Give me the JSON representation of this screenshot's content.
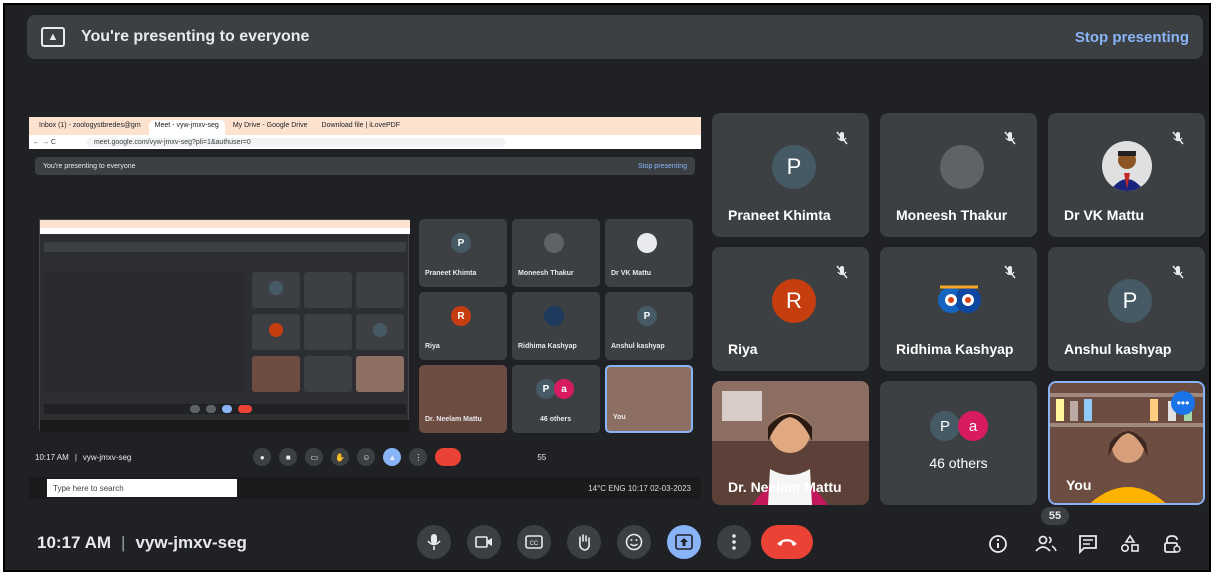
{
  "banner": {
    "message": "You're presenting to everyone",
    "stop_label": "Stop presenting"
  },
  "shared_screen": {
    "tabs": [
      "Inbox (1) - zoologystbredes@gm",
      "Meet - vyw-jmxv-seg",
      "My Drive - Google Drive",
      "Download file | iLovePDF"
    ],
    "url": "meet.google.com/vyw-jmxv-seg?pli=1&authuser=0",
    "banner_message": "You're presenting to everyone",
    "banner_stop": "Stop presenting",
    "tiles": [
      "Praneet Khimta",
      "Moneesh Thakur",
      "Dr VK Mattu",
      "Riya",
      "Ridhima Kashyap",
      "Anshul kashyap",
      "Dr. Neelam Mattu",
      "46 others",
      "You"
    ],
    "clock": "10:17 AM",
    "meeting_code": "vyw-jmxv-seg",
    "participant_count": "55",
    "taskbar_search": "Type here to search",
    "tray_text": "14°C  ENG  10:17  02-03-2023"
  },
  "participants": [
    {
      "name": "Praneet Khimta",
      "initial": "P",
      "avatar_color": "#455a64",
      "type": "initial"
    },
    {
      "name": "Moneesh Thakur",
      "initial": "",
      "avatar_color": "#5f6368",
      "type": "blank"
    },
    {
      "name": "Dr VK Mattu",
      "initial": "",
      "type": "photo"
    },
    {
      "name": "Riya",
      "initial": "R",
      "avatar_color": "#c63d0f",
      "type": "initial"
    },
    {
      "name": "Ridhima Kashyap",
      "initial": "",
      "type": "photo-art"
    },
    {
      "name": "Anshul kashyap",
      "initial": "P",
      "avatar_color": "#455a64",
      "type": "initial"
    }
  ],
  "video_tiles": {
    "neelam": "Dr. Neelam Mattu",
    "self": "You"
  },
  "others": {
    "initial_1": "P",
    "initial_2": "a",
    "label": "46 others"
  },
  "bottom_bar": {
    "time": "10:17 AM",
    "meeting_code": "vyw-jmxv-seg",
    "participant_count": "55"
  },
  "colors": {
    "background": "#202124",
    "tile": "#3c4043",
    "accent": "#8ab4f8",
    "end_call": "#ea4335"
  }
}
